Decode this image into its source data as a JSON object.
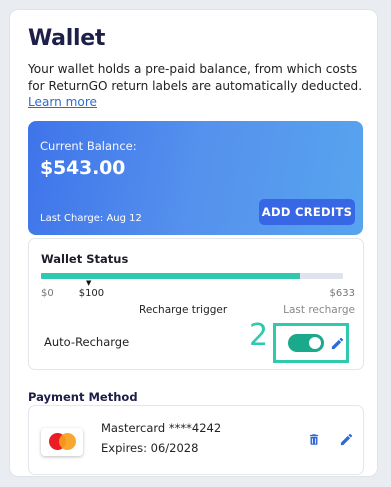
{
  "wallet": {
    "title": "Wallet",
    "description": "Your wallet holds a pre-paid balance, from which costs for ReturnGO return labels are automatically deducted.",
    "learn_more": "Learn more"
  },
  "balance": {
    "label": "Current Balance:",
    "amount": "$543.00",
    "last_charge": "Last Charge: Aug 12",
    "add_credits": "ADD CREDITS"
  },
  "status": {
    "title": "Wallet Status",
    "progress_fraction": 0.857,
    "trigger_fraction": 0.158,
    "tick_min": "$0",
    "tick_trigger": "$100",
    "tick_max": "$633",
    "trigger_label": "Recharge trigger",
    "last_recharge_label": "Last recharge",
    "auto_recharge_label": "Auto-Recharge",
    "auto_recharge_on": true,
    "callout_number": "2"
  },
  "payment": {
    "title": "Payment Method",
    "card_line1": "Mastercard ****4242",
    "card_line2": "Expires: 06/2028"
  },
  "colors": {
    "accent": "#2ec9ae",
    "brand_blue": "#3867e6",
    "icon_blue": "#2e6ad6"
  },
  "icons": {
    "edit": "pencil-icon",
    "delete": "trash-icon",
    "card": "mastercard-logo"
  }
}
